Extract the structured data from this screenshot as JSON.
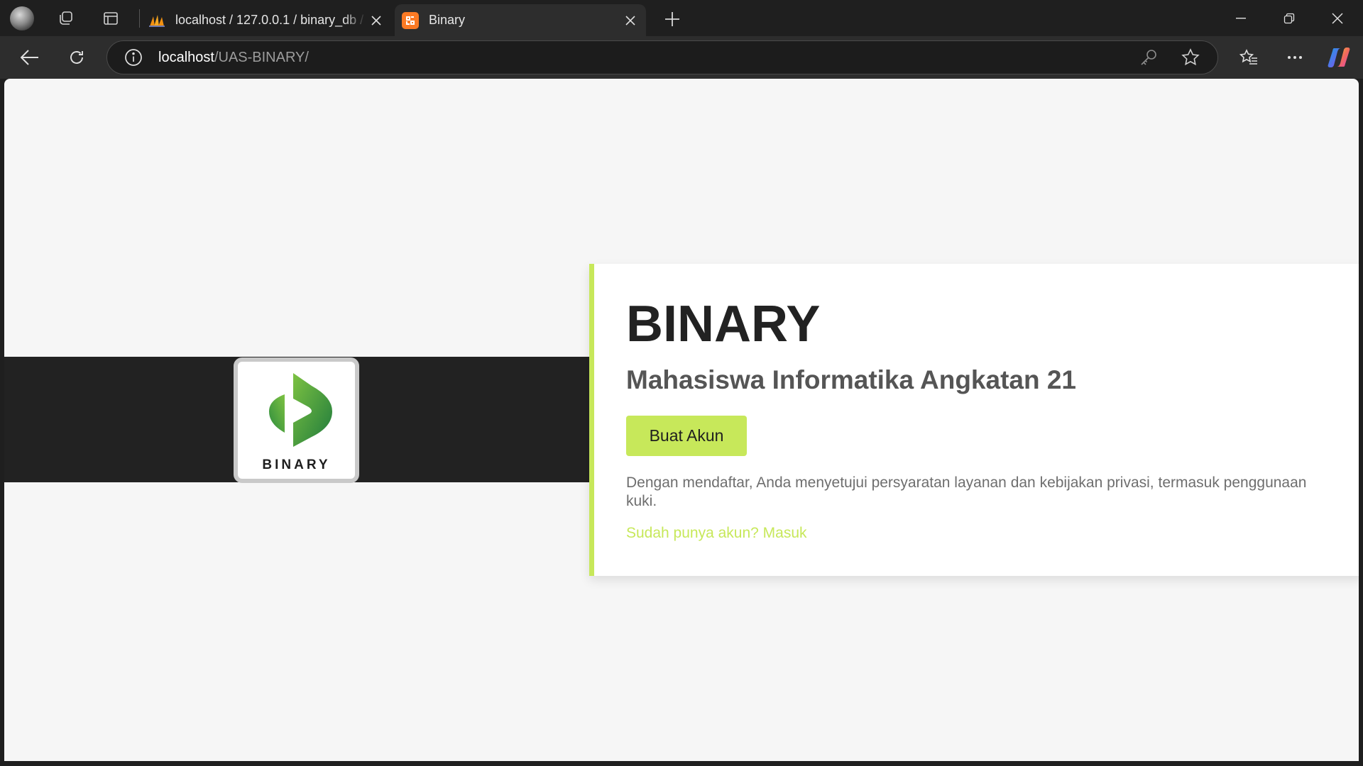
{
  "browser": {
    "tabs": [
      {
        "title": "localhost / 127.0.0.1 / binary_db / ",
        "favicon": "phpmyadmin-icon",
        "active": false
      },
      {
        "title": "Binary",
        "favicon": "xampp-icon",
        "active": true
      }
    ],
    "address_bar": {
      "host": "localhost",
      "path": "/UAS-BINARY/"
    }
  },
  "page": {
    "logo_text": "BINARY",
    "heading": "BINARY",
    "subheading": "Mahasiswa Informatika Angkatan 21",
    "cta_label": "Buat Akun",
    "terms_text": "Dengan mendaftar, Anda menyetujui persyaratan layanan dan kebijakan privasi, termasuk penggunaan kuki.",
    "login_link": "Sudah punya akun? Masuk"
  },
  "colors": {
    "accent": "#c7e85a",
    "dark_band": "#222222",
    "page_bg": "#f6f6f6",
    "logo_green_dark": "#1e7a3c",
    "logo_green_light": "#7dc242"
  }
}
